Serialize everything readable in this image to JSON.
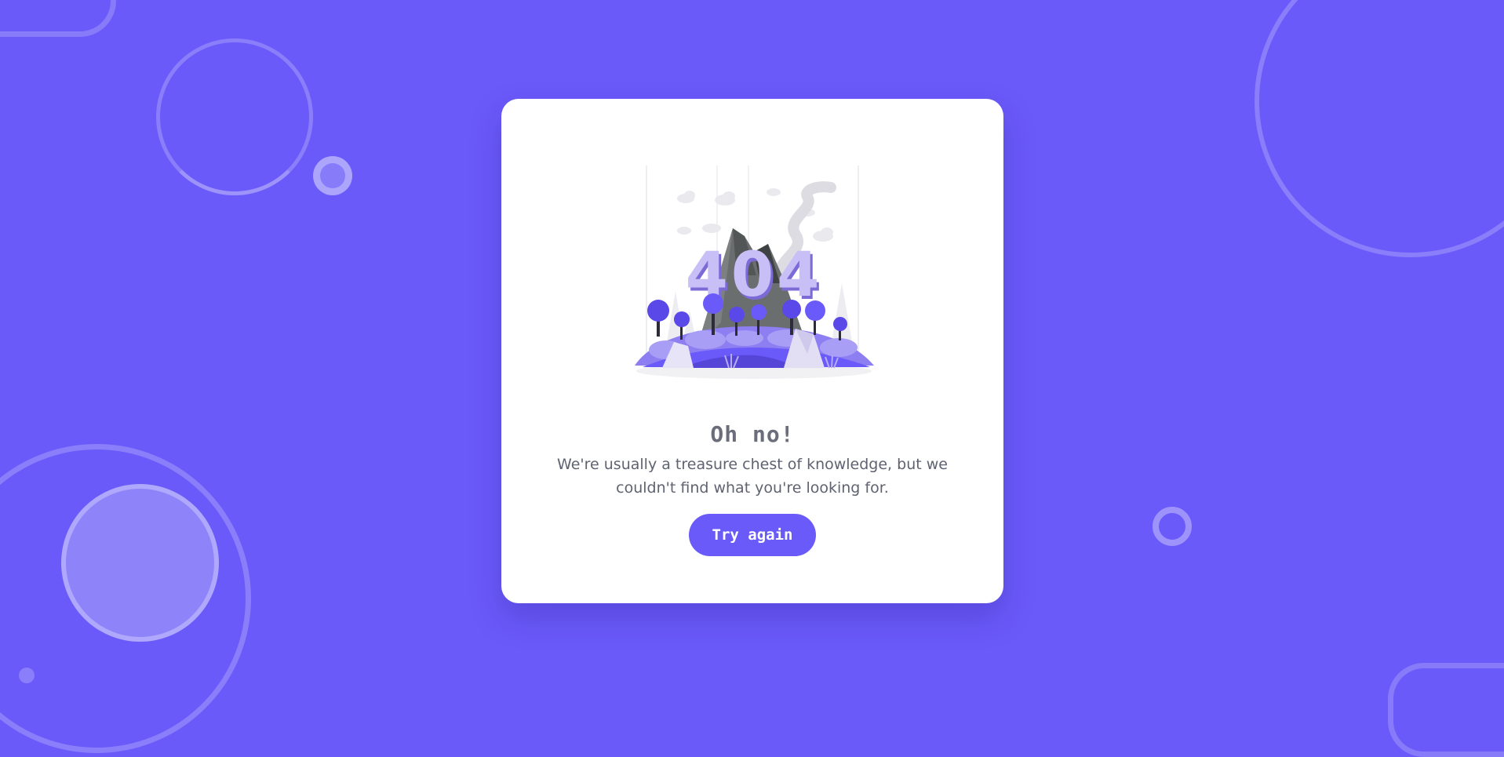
{
  "error": {
    "title": "Oh no!",
    "message": "We're usually a treasure chest of knowledge, but we couldn't find what you're looking for.",
    "illustration_text": "404",
    "retry_label": "Try again"
  },
  "colors": {
    "background": "#6a5af9",
    "card": "#ffffff",
    "accent": "#6a5af9",
    "text": "#5f6270"
  }
}
